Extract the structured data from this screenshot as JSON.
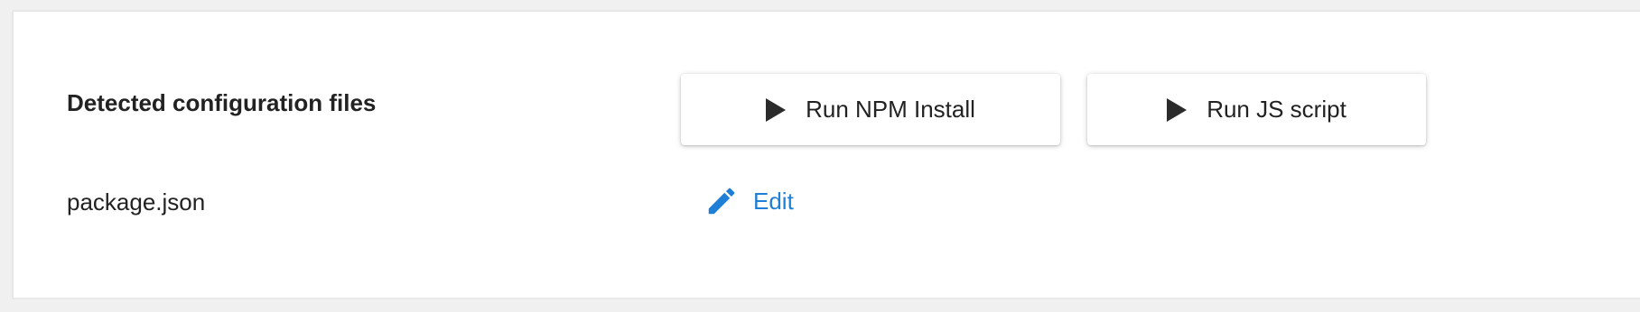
{
  "section": {
    "title": "Detected configuration files"
  },
  "actions": {
    "npm_install_label": "Run NPM Install",
    "js_script_label": "Run JS script",
    "play_icon": "play-icon"
  },
  "files": [
    {
      "name": "package.json",
      "edit_label": "Edit",
      "edit_icon": "pencil-icon"
    }
  ],
  "colors": {
    "link": "#1f7ed6",
    "text": "#222222",
    "icon": "#2b2b2b"
  }
}
